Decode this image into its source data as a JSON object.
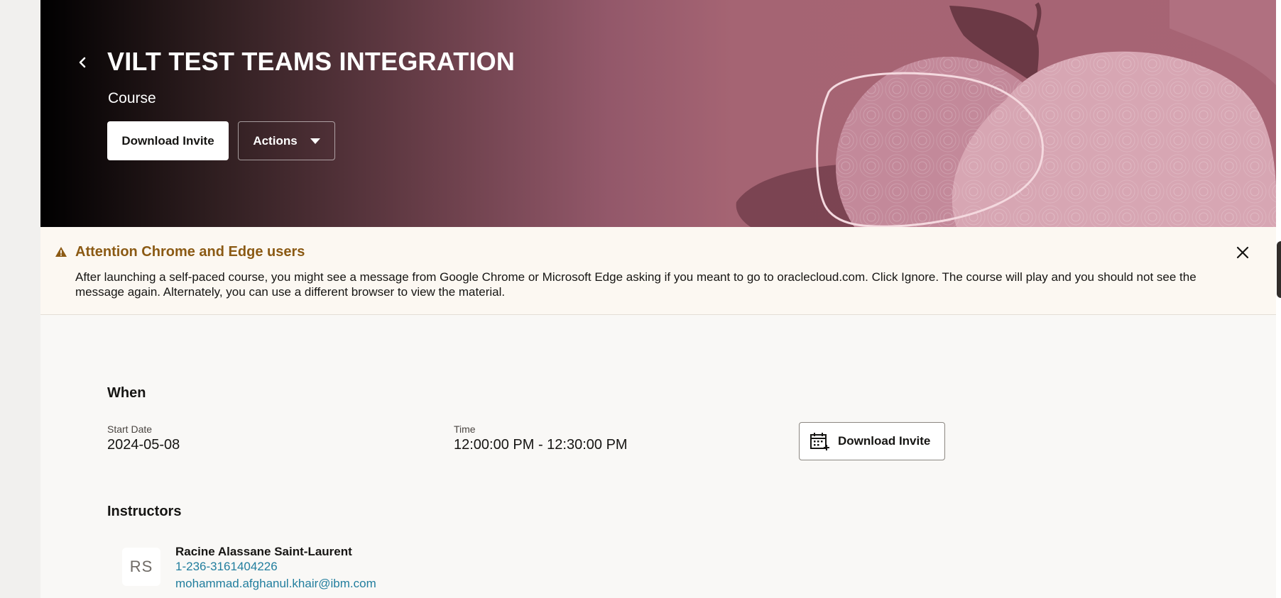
{
  "header": {
    "title": "VILT TEST TEAMS INTEGRATION",
    "subtitle": "Course",
    "download_invite_label": "Download Invite",
    "actions_label": "Actions"
  },
  "banner": {
    "title": "Attention Chrome and Edge users",
    "message": "After launching a self-paced course, you might see a message from Google Chrome or Microsoft Edge asking if you meant to go to oraclecloud.com. Click Ignore. The course will play and you should not see the message again. Alternately, you can use a different browser to view the material."
  },
  "when": {
    "heading": "When",
    "start_date_label": "Start Date",
    "start_date_value": "2024-05-08",
    "time_label": "Time",
    "time_value": "12:00:00 PM - 12:30:00 PM",
    "download_invite_label": "Download Invite"
  },
  "instructors": {
    "heading": "Instructors",
    "items": [
      {
        "initials": "RS",
        "name": "Racine Alassane Saint-Laurent",
        "phone": "1-236-3161404226",
        "email": "mohammad.afghanul.khair@ibm.com"
      }
    ]
  },
  "colors": {
    "hero_gradient_start": "#000000",
    "hero_gradient_end": "#a76474",
    "banner_background": "#fcf8f2",
    "warning_accent": "#8b5a14",
    "link": "#227e9e",
    "page_background": "#f9f8f6"
  },
  "icons": {
    "back": "chevron-left-icon",
    "actions_caret": "caret-down-icon",
    "warning": "warning-triangle-icon",
    "close": "close-icon",
    "calendar": "calendar-add-icon"
  }
}
